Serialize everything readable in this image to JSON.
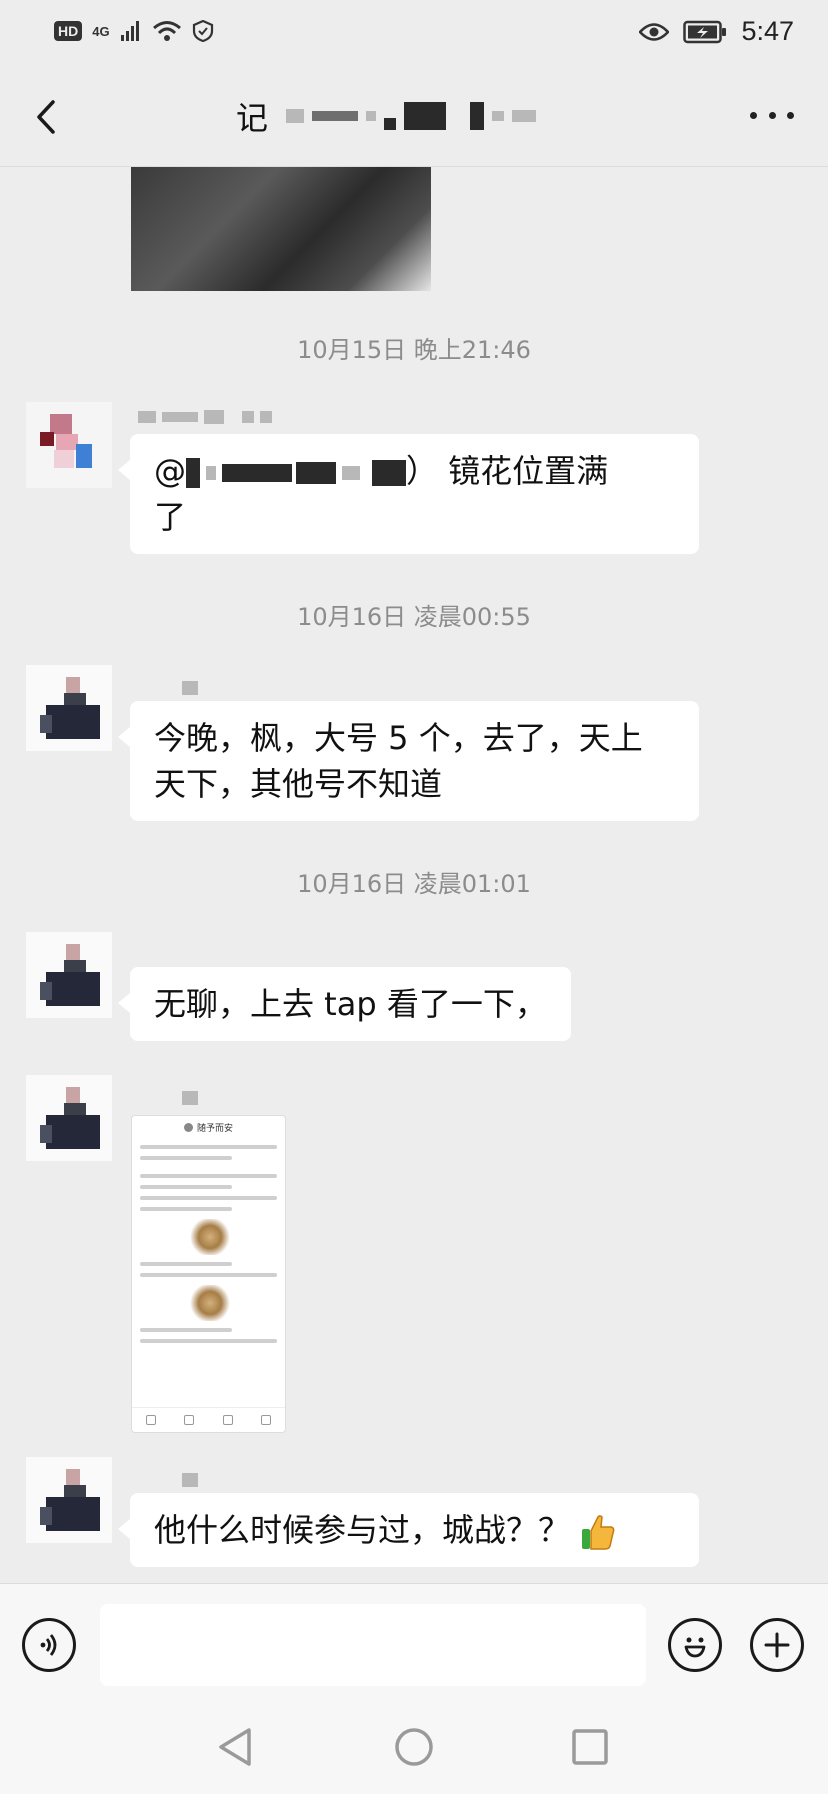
{
  "status_bar": {
    "hd": "HD",
    "network": "4G",
    "time": "5:47"
  },
  "header": {
    "title_first_char": "记",
    "icons": [
      "back-arrow-icon",
      "more-dots-icon"
    ]
  },
  "messages": [
    {
      "type": "timestamp",
      "text": "10月15日 晚上21:46"
    },
    {
      "type": "text",
      "prefix": "@",
      "after_mention": "） 镜花位置满",
      "line2": "了"
    },
    {
      "type": "timestamp",
      "text": "10月16日 凌晨00:55"
    },
    {
      "type": "text",
      "line1": "今晚，枫，大号 5 个，去了，天上",
      "line2": "天下，其他号不知道"
    },
    {
      "type": "timestamp",
      "text": "10月16日 凌晨01:01"
    },
    {
      "type": "text",
      "line1": "无聊，上去 tap 看了一下，"
    },
    {
      "type": "image",
      "mini_title": "随予而安"
    },
    {
      "type": "text",
      "line1": "他什么时候参与过，城战？？",
      "emoji": "thumbs-up"
    }
  ],
  "input_bar": {
    "value": "",
    "icons": [
      "voice-icon",
      "emoji-icon",
      "plus-icon"
    ]
  },
  "colors": {
    "background": "#ededed",
    "bubble": "#ffffff",
    "timestamp": "#8c8c8c"
  }
}
